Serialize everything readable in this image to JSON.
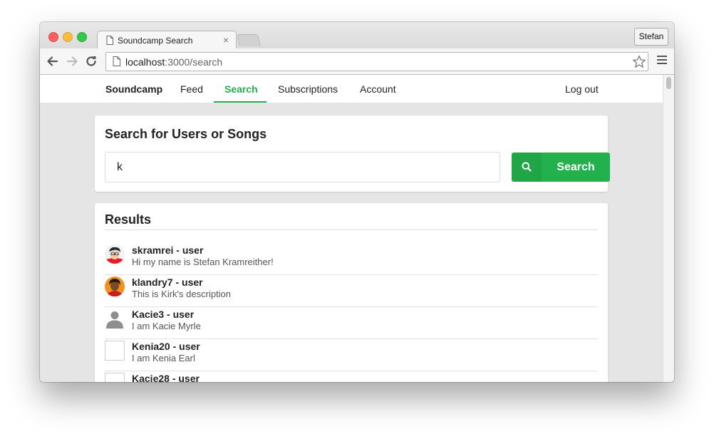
{
  "browser": {
    "tab_title": "Soundcamp Search",
    "tab_close": "×",
    "profile_name": "Stefan",
    "url_host": "localhost",
    "url_rest": ":3000/search"
  },
  "nav": {
    "brand": "Soundcamp",
    "links": [
      "Feed",
      "Search",
      "Subscriptions",
      "Account"
    ],
    "active": "Search",
    "logout": "Log out"
  },
  "search": {
    "heading": "Search for Users or Songs",
    "query": "k",
    "button_label": "Search"
  },
  "results": {
    "heading": "Results",
    "items": [
      {
        "name": "skramrei - user",
        "description": "Hi my name is Stefan Kramreither!",
        "avatar": "cartoon-portrait"
      },
      {
        "name": "klandry7 - user",
        "description": "This is Kirk's description",
        "avatar": "orange-portrait"
      },
      {
        "name": "Kacie3 - user",
        "description": "I am Kacie Myrle",
        "avatar": "default-user-silhouette"
      },
      {
        "name": "Kenia20 - user",
        "description": "I am Kenia Earl",
        "avatar": "blank"
      },
      {
        "name": "Kacie28 - user",
        "description": "",
        "avatar": "blank"
      }
    ]
  },
  "colors": {
    "accent": "#22b14c",
    "page_background": "#e5e5e5"
  }
}
